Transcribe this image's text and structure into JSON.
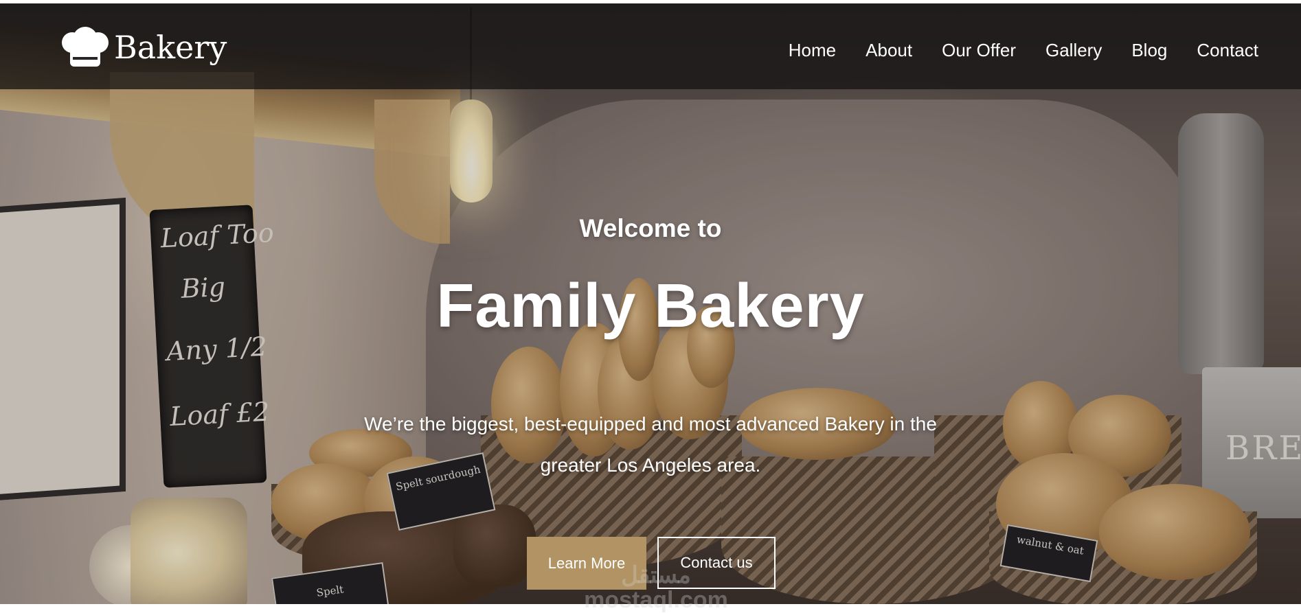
{
  "brand": {
    "name": "Bakery",
    "logo_icon": "chef-hat-icon"
  },
  "nav": {
    "items": [
      {
        "label": "Home"
      },
      {
        "label": "About"
      },
      {
        "label": "Our Offer"
      },
      {
        "label": "Gallery"
      },
      {
        "label": "Blog"
      },
      {
        "label": "Contact"
      }
    ]
  },
  "hero": {
    "welcome": "Welcome to",
    "title": "Family Bakery",
    "description": "We’re the biggest, best-equipped and most advanced Bakery in the greater Los Angeles area.",
    "buttons": {
      "learn_more": "Learn More",
      "contact_us": "Contact us"
    },
    "background_signs": {
      "chalkboard": [
        "Loaf Too",
        "Big",
        "Any 1/2",
        "Loaf £2"
      ],
      "tag_spelt_sourdough": "Spelt sourdough",
      "tag_spelt": "Spelt",
      "tag_walnut": "walnut & oat",
      "bin_text": "BRE"
    }
  },
  "watermark": {
    "arabic": "مستقل",
    "latin": "mostaql.com"
  },
  "colors": {
    "nav_bg": "#161415",
    "accent_button": "#b29363",
    "text": "#ffffff"
  }
}
